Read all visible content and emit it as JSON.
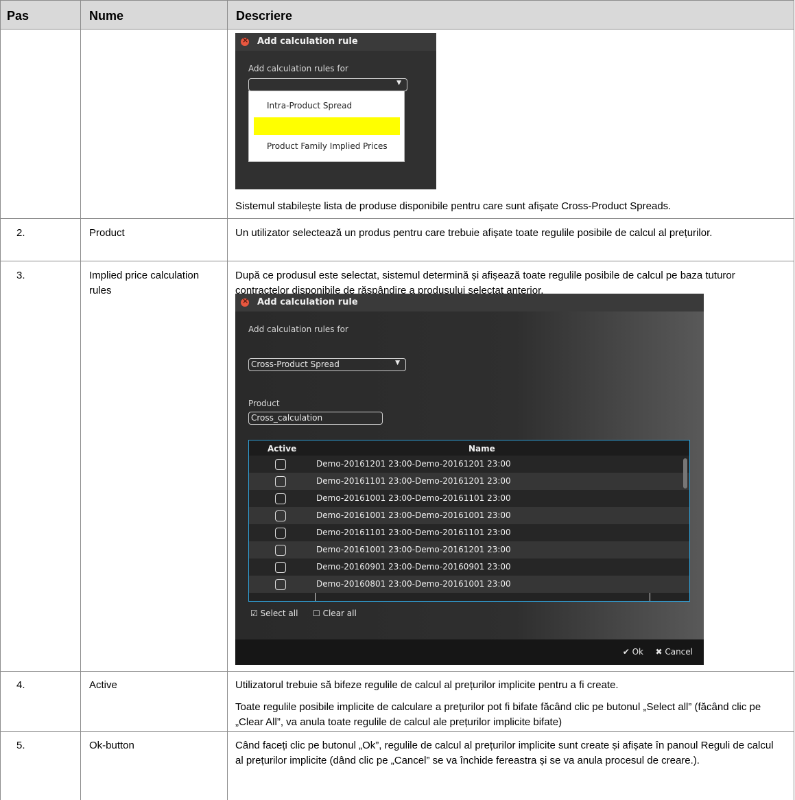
{
  "table": {
    "headers": {
      "step": "Pas",
      "name": "Nume",
      "description": "Descriere"
    },
    "rows": [
      {
        "step": "",
        "name": "",
        "description": "Sistemul stabilește lista de produse disponibile pentru care sunt afișate Cross-Product Spreads."
      },
      {
        "step": "2.",
        "name": "Product",
        "description": "Un utilizator selectează un produs pentru care trebuie afișate toate regulile posibile de calcul al prețurilor."
      },
      {
        "step": "3.",
        "name": "Implied price calculation rules",
        "description": "După ce produsul este selectat, sistemul determină și afișează toate regulile posibile de calcul pe baza tuturor contractelor disponibile de răspândire a produsului selectat anterior."
      },
      {
        "step": "4.",
        "name": "Active",
        "description": "Utilizatorul trebuie să bifeze regulile de calcul al prețurilor implicite pentru a fi create.",
        "description2": "Toate regulile posibile implicite de calculare a prețurilor pot fi bifate făcând clic pe butonul „Select all” (făcând clic pe „Clear All”, va anula toate regulile de calcul ale prețurilor implicite bifate)"
      },
      {
        "step": "5.",
        "name": "Ok-button",
        "description": "Când faceți clic pe butonul „Ok”, regulile de calcul al prețurilor implicite sunt create și afișate în panoul Reguli de calcul al prețurilor implicite (dând clic pe „Cancel” se va închide fereastra și se va anula procesul de creare.)."
      }
    ]
  },
  "dialog1": {
    "title": "Add calculation rule",
    "label": "Add calculation rules for",
    "combo_value": "",
    "options": [
      "Intra-Product Spread",
      "",
      "Product Family Implied Prices"
    ],
    "highlight_color": "#ffff00"
  },
  "dialog2": {
    "title": "Add calculation rule",
    "label": "Add calculation rules for",
    "combo_value": "Cross-Product Spread",
    "product_label": "Product",
    "product_value": "Cross_calculation",
    "columns": [
      "Active",
      "Name"
    ],
    "rows": [
      "Demo-20161201 23:00-Demo-20161201 23:00",
      "Demo-20161101 23:00-Demo-20161201 23:00",
      "Demo-20161001 23:00-Demo-20161101 23:00",
      "Demo-20161001 23:00-Demo-20161001 23:00",
      "Demo-20161101 23:00-Demo-20161101 23:00",
      "Demo-20161001 23:00-Demo-20161201 23:00",
      "Demo-20160901 23:00-Demo-20160901 23:00",
      "Demo-20160801 23:00-Demo-20161001 23:00"
    ],
    "select_all": "Select all",
    "clear_all": "Clear all",
    "ok": "Ok",
    "cancel": "Cancel",
    "accent_color": "#2f9fd6"
  }
}
